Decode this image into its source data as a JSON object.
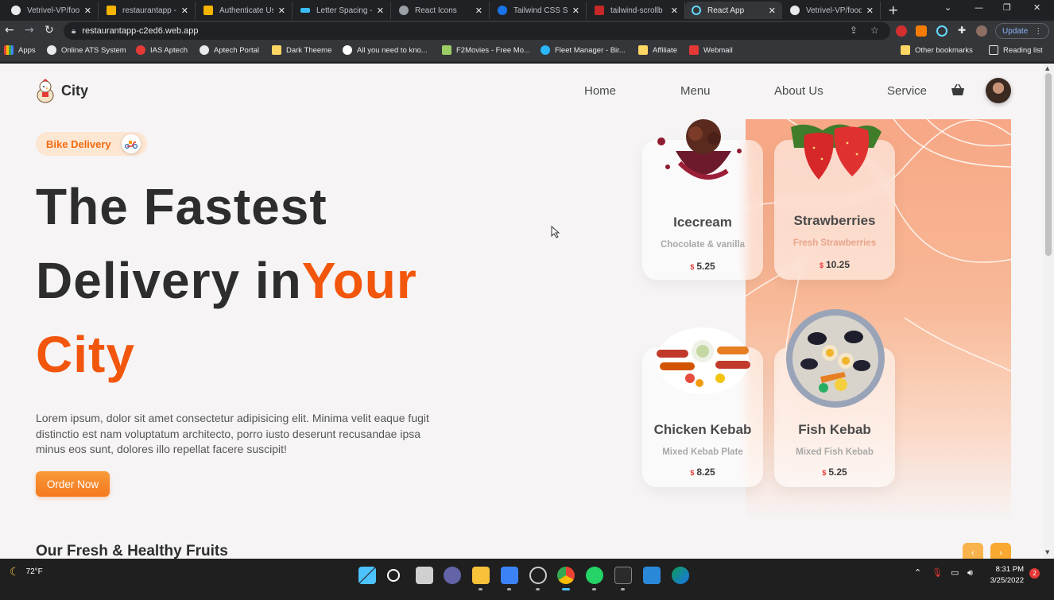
{
  "browser": {
    "tabs": [
      {
        "title": "Vetrivel-VP/food",
        "color": "#e8eaed"
      },
      {
        "title": "restaurantapp -",
        "color": "#f4b400"
      },
      {
        "title": "Authenticate Us",
        "color": "#f4b400"
      },
      {
        "title": "Letter Spacing -",
        "color": "#38bdf8"
      },
      {
        "title": "React Icons",
        "color": "#9aa0a6"
      },
      {
        "title": "Tailwind CSS Sp",
        "color": "#1a73e8"
      },
      {
        "title": "tailwind-scrollb",
        "color": "#c62828"
      },
      {
        "title": "React App",
        "color": "#61dafb"
      },
      {
        "title": "Vetrivel-VP/food",
        "color": "#e8eaed"
      }
    ],
    "url": "restaurantapp-c2ed6.web.app",
    "update_label": "Update",
    "bookmarks": [
      "Apps",
      "Online ATS System",
      "IAS Aptech",
      "Aptech Portal",
      "Dark Theeme",
      "All you need to kno...",
      "F2Movies - Free Mo...",
      "Fleet Manager - Bir...",
      "Affiliate",
      "Webmail"
    ],
    "other_bookmarks": "Other bookmarks",
    "reading_list": "Reading list"
  },
  "page": {
    "brand": "City",
    "nav": [
      "Home",
      "Menu",
      "About Us",
      "Service"
    ],
    "badge": "Bike Delivery",
    "hero_line1": "The Fastest",
    "hero_line2_dark": "Delivery in",
    "hero_line2_accent": "Your",
    "hero_line3": "City",
    "description": "Lorem ipsum, dolor sit amet consectetur adipisicing elit. Minima velit eaque fugit distinctio est nam voluptatum architecto, porro iusto deserunt recusandae ipsa minus eos sunt, dolores illo repellat facere suscipit!",
    "order_button": "Order Now",
    "cards": [
      {
        "name": "Icecream",
        "desc": "Chocolate & vanilla",
        "currency": "$",
        "price": "5.25"
      },
      {
        "name": "Strawberries",
        "desc": "Fresh Strawberries",
        "currency": "$",
        "price": "10.25"
      },
      {
        "name": "Chicken Kebab",
        "desc": "Mixed Kebab Plate",
        "currency": "$",
        "price": "8.25"
      },
      {
        "name": "Fish Kebab",
        "desc": "Mixed Fish Kebab",
        "currency": "$",
        "price": "5.25"
      }
    ],
    "section_title": "Our Fresh & Healthy Fruits",
    "prev_glyph": "‹",
    "next_glyph": "›",
    "accent_color": "#f2560c"
  },
  "taskbar": {
    "weather": "72°F",
    "time": "8:31 PM",
    "date": "3/25/2022",
    "notifications": "2"
  }
}
